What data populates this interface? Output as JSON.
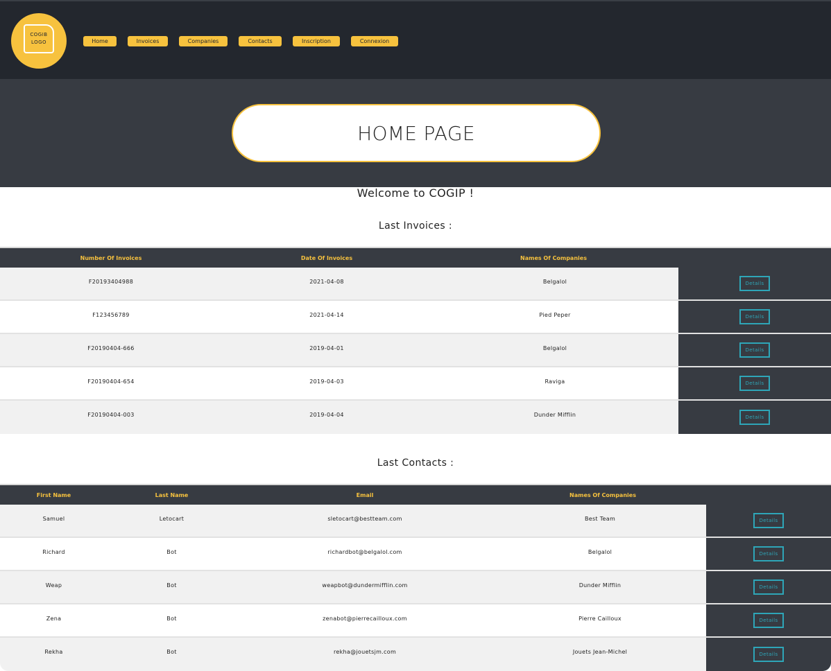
{
  "header": {
    "logo_lines": [
      "COGIB",
      "LOGO"
    ],
    "nav": [
      "Home",
      "Invoices",
      "Companies",
      "Contacts",
      "Inscription",
      "Connexion"
    ]
  },
  "hero": {
    "title": "HOME PAGE"
  },
  "welcome": "Welcome to COGIP !",
  "invoices": {
    "title": "Last Invoices :",
    "columns": [
      "Number Of Invoices",
      "Date Of Invoices",
      "Names Of Companies"
    ],
    "rows": [
      [
        "F20193404988",
        "2021-04-08",
        "Belgalol"
      ],
      [
        "F123456789",
        "2021-04-14",
        "Pied Peper"
      ],
      [
        "F20190404-666",
        "2019-04-01",
        "Belgalol"
      ],
      [
        "F20190404-654",
        "2019-04-03",
        "Raviga"
      ],
      [
        "F20190404-003",
        "2019-04-04",
        "Dunder Mifflin"
      ]
    ],
    "action_label": "Details"
  },
  "contacts": {
    "title": "Last Contacts :",
    "columns": [
      "First Name",
      "Last Name",
      "Email",
      "Names Of Companies"
    ],
    "rows": [
      [
        "Samuel",
        "Letocart",
        "sletocart@bestteam.com",
        "Best Team"
      ],
      [
        "Richard",
        "Bot",
        "richardbot@belgalol.com",
        "Belgalol"
      ],
      [
        "Weap",
        "Bot",
        "weapbot@dundermifflin.com",
        "Dunder Mifflin"
      ],
      [
        "Zena",
        "Bot",
        "zenabot@pierrecailloux.com",
        "Pierre Cailloux"
      ],
      [
        "Rekha",
        "Bot",
        "rekha@jouetsjm.com",
        "Jouets Jean-Michel"
      ]
    ],
    "action_label": "Details"
  },
  "colors": {
    "accent": "#f7c23e",
    "dark": "#23272e",
    "panel": "#373b42",
    "button": "#2ea6b8"
  }
}
